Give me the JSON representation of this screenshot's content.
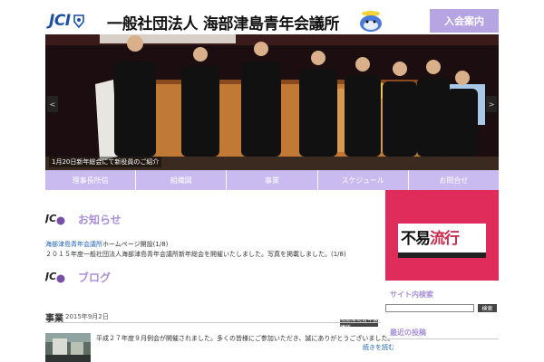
{
  "header": {
    "logo_text": "JCI",
    "site_title": "一般社団法人 海部津島青年会議所",
    "join_label": "入会案内"
  },
  "slider": {
    "caption": "1月20日新年総会にて新役員のご紹介",
    "prev": "<",
    "next": ">"
  },
  "nav": {
    "items": [
      {
        "label": "理事長所信"
      },
      {
        "label": "組織図"
      },
      {
        "label": "事業"
      },
      {
        "label": "スケジュール"
      },
      {
        "label": "お問合せ"
      }
    ]
  },
  "news": {
    "title": "お知らせ",
    "items": [
      {
        "link": "海部津島青年会議所",
        "text": "ホームページ開設(1/8)"
      },
      {
        "text": "２０１５年度一般社団法人海部津島青年会議所新年総会を開催いたしました。写真を掲載しました。(1/8)"
      }
    ]
  },
  "blog": {
    "title": "ブログ",
    "category": "事業",
    "date": "2015年9月2日",
    "tag": "海部津島青年会議所",
    "text": "平成２７年度９月例会が開催されました。多くの皆様にご参加いただき、誠にありがとうございました。",
    "more": "続きを読む"
  },
  "sidebar": {
    "banner_title_1": "不易",
    "banner_title_2": "流行",
    "search_heading": "サイト内検索",
    "search_placeholder": "",
    "search_button": "検索",
    "recent_heading": "最近の投稿"
  },
  "colors": {
    "accent": "#b6a5e3",
    "nav": "#c9bbf0",
    "banner": "#e02c5a",
    "link": "#1a5fb4"
  }
}
